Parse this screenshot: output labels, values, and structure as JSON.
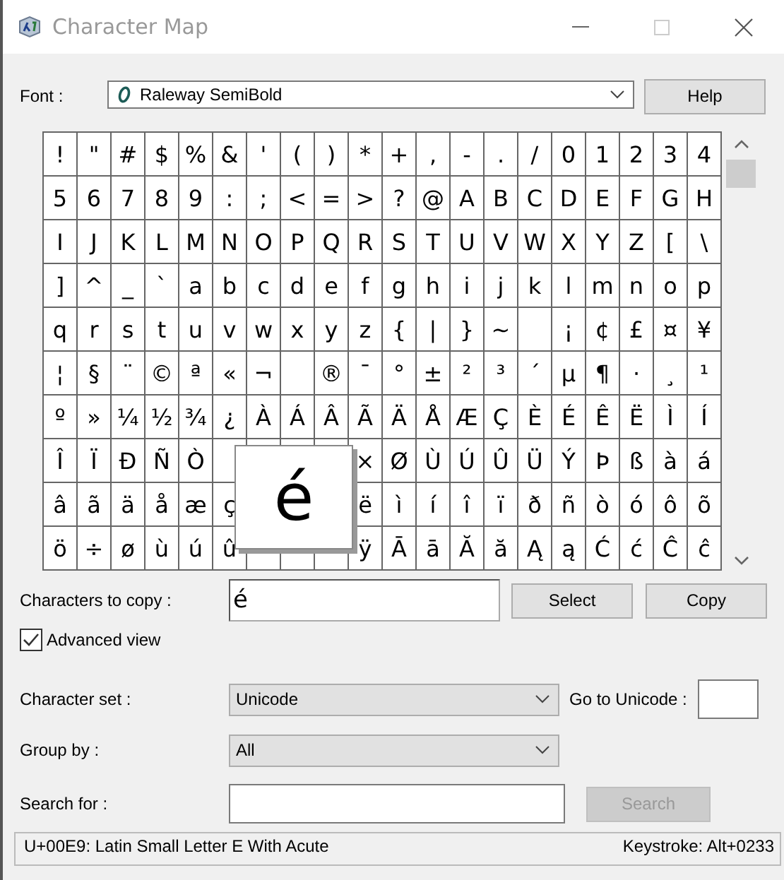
{
  "window": {
    "title": "Character Map"
  },
  "font": {
    "label": "Font :",
    "value": "Raleway SemiBold"
  },
  "help_button": "Help",
  "grid": {
    "rows": [
      [
        "!",
        "\"",
        "#",
        "$",
        "%",
        "&",
        "'",
        "(",
        ")",
        "*",
        "+",
        ",",
        "-",
        ".",
        "/",
        "0",
        "1",
        "2",
        "3",
        "4"
      ],
      [
        "5",
        "6",
        "7",
        "8",
        "9",
        ":",
        ";",
        "<",
        "=",
        ">",
        "?",
        "@",
        "A",
        "B",
        "C",
        "D",
        "E",
        "F",
        "G",
        "H"
      ],
      [
        "I",
        "J",
        "K",
        "L",
        "M",
        "N",
        "O",
        "P",
        "Q",
        "R",
        "S",
        "T",
        "U",
        "V",
        "W",
        "X",
        "Y",
        "Z",
        "[",
        "\\"
      ],
      [
        "]",
        "^",
        "_",
        "`",
        "a",
        "b",
        "c",
        "d",
        "e",
        "f",
        "g",
        "h",
        "i",
        "j",
        "k",
        "l",
        "m",
        "n",
        "o",
        "p"
      ],
      [
        "q",
        "r",
        "s",
        "t",
        "u",
        "v",
        "w",
        "x",
        "y",
        "z",
        "{",
        "|",
        "}",
        "~",
        null,
        "¡",
        "¢",
        "£",
        "¤",
        "¥"
      ],
      [
        "¦",
        "§",
        "¨",
        "©",
        "ª",
        "«",
        "¬",
        null,
        "®",
        "¯",
        "°",
        "±",
        "²",
        "³",
        "´",
        "µ",
        "¶",
        "·",
        "¸",
        "¹"
      ],
      [
        "º",
        "»",
        "¼",
        "½",
        "¾",
        "¿",
        "À",
        "Á",
        "Â",
        "Ã",
        "Ä",
        "Å",
        "Æ",
        "Ç",
        "È",
        "É",
        "Ê",
        "Ë",
        "Ì",
        "Í"
      ],
      [
        "Î",
        "Ï",
        "Ð",
        "Ñ",
        "Ò",
        null,
        null,
        null,
        null,
        "×",
        "Ø",
        "Ù",
        "Ú",
        "Û",
        "Ü",
        "Ý",
        "Þ",
        "ß",
        "à",
        "á"
      ],
      [
        "â",
        "ã",
        "ä",
        "å",
        "æ",
        "ç",
        null,
        null,
        null,
        "ë",
        "ì",
        "í",
        "î",
        "ï",
        "ð",
        "ñ",
        "ò",
        "ó",
        "ô",
        "õ"
      ],
      [
        "ö",
        "÷",
        "ø",
        "ù",
        "ú",
        "û",
        null,
        null,
        null,
        "ÿ",
        "Ā",
        "ā",
        "Ă",
        "ă",
        "Ą",
        "ą",
        "Ć",
        "ć",
        "Ĉ",
        "ĉ"
      ]
    ]
  },
  "zoom_popup": {
    "char": "é"
  },
  "copy": {
    "label": "Characters to copy :",
    "value": "é",
    "select_button": "Select",
    "copy_button": "Copy"
  },
  "advanced_view": {
    "label": "Advanced view",
    "checked": true
  },
  "character_set": {
    "label": "Character set :",
    "value": "Unicode"
  },
  "goto_unicode": {
    "label": "Go to Unicode :"
  },
  "group_by": {
    "label": "Group by :",
    "value": "All"
  },
  "search": {
    "label": "Search for :",
    "button": "Search",
    "button_disabled": true
  },
  "status_bar": {
    "left": "U+00E9: Latin Small Letter E With Acute",
    "right": "Keystroke: Alt+0233"
  }
}
